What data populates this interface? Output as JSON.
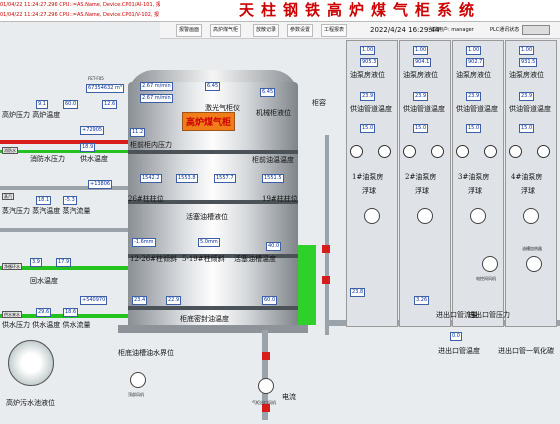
{
  "alarms": [
    "01/04/22  11:24:27.296 CPU::=AS.Name, Device:CP01/AI-101, 报",
    "01/04/22  11:24:27.296 CPU::=AS.Name, Device:CP01/V-102, 报"
  ],
  "title": "天柱钢铁高炉煤气柜系统",
  "toolbar": {
    "buttons": [
      "报警画面",
      "高炉煤气柜",
      "放散记录",
      "参数设置",
      "工程报表"
    ],
    "datetime": "2022/4/24 16:29:44",
    "user_prefix": "当前用户:",
    "user": "manager",
    "plc_label": "PLC通讯状态"
  },
  "tank": {
    "label": "高炉煤气柜",
    "readings": {
      "level_top": "2.67 m/min",
      "level_top2": "2.67 m/min",
      "gas_top_left": "6.45",
      "gas_top_right": "6.45",
      "inner_pressure": "11.2",
      "piston_val1": "1542.2",
      "piston_val2": "1553.8",
      "piston_val3": "1557.7",
      "piston_val4": "1551.5",
      "oil_level": "40.0",
      "slant1": "-1.6mm",
      "slant2": "5.0mm",
      "bottom1": "23.4",
      "bottom2": "22.9",
      "bottom3": "60.0",
      "middle": "0.0"
    },
    "labels": {
      "gas_analyzer": "激光气柜仪",
      "smoke": "机械柜液位",
      "top_pressure": "柜前柜内压力",
      "oil_temp": "柜前油温温度",
      "piston_left": "26#柱柱位",
      "piston_right": "19#柱柱位",
      "piston_level": "活塞油槽液位",
      "slant_left": "12-26#柱倾斜",
      "slant_right": "5-19#柱倾斜",
      "piston_temp": "活塞油槽温度",
      "seal_temp": "柜底密封油温度",
      "bottom_level": "柜底油槽油水界位",
      "rongqi": "柜容"
    }
  },
  "left_panel": {
    "header1": "FET-F05",
    "flow1": "67354632",
    "flow1_unit": "m³",
    "p1": "9.1",
    "t1": "60.0",
    "t2": "12.6",
    "row1": "高炉压力 高炉温度",
    "row2": "高炉流量",
    "flow2": "+72905",
    "row3": "消防水压力",
    "row4": "供水温度",
    "p3": "18.9",
    "row5": "蒸汽压力 蒸汽温度 蒸汽流量",
    "flow3": "+13806",
    "p5": "18.1",
    "p6": "-5.3",
    "row6": "回水压力",
    "row7": "回水温度",
    "v7": "3.9",
    "v8": "17.9",
    "row8": "供水压力 供水温度 供水流量",
    "flow4": "+540970",
    "v9": "29.6",
    "v10": "18.6",
    "sewage": "高炉污水池液位",
    "src1": "高炉来气",
    "src2": "蒸汽",
    "src3": "消防水",
    "src4": "净循环水",
    "src5": "供水来水"
  },
  "rooms": [
    {
      "name": "1#油泵房",
      "float": "浮球",
      "tank_level": "油泵房液位",
      "temp": "供油管道温度",
      "level": "1.00",
      "p1": "905.3",
      "p2": "23.9",
      "t": "15.0"
    },
    {
      "name": "2#油泵房",
      "float": "浮球",
      "tank_level": "油泵房液位",
      "temp": "供油管道温度",
      "level": "1.00",
      "p1": "904.1",
      "p2": "23.9",
      "t": "15.0"
    },
    {
      "name": "3#油泵房",
      "float": "浮球",
      "tank_level": "油泵房液位",
      "temp": "供油管道温度",
      "level": "1.00",
      "p1": "902.7",
      "p2": "23.9",
      "t": "15.0"
    },
    {
      "name": "4#油泵房",
      "float": "浮球",
      "tank_level": "油泵房液位",
      "temp": "供油管道温度",
      "level": "1.00",
      "p1": "931.5",
      "p2": "23.9",
      "t": "15.0"
    }
  ],
  "bottom_right": {
    "inlet_pressure": "进出口管压力",
    "inlet_temp": "进出口管温度",
    "co": "进出口管一氧化碳",
    "inlet_flow": "进出口管流量",
    "fan_room": "电控间风机",
    "heater": "油槽加热器",
    "v1": "23.8",
    "v2": "3.26",
    "v3": "0.0"
  },
  "bottom_left": {
    "fan1": "顶部风机",
    "fan2": "气柜出口风机",
    "wind": "风机",
    "dianliu": "电流"
  }
}
